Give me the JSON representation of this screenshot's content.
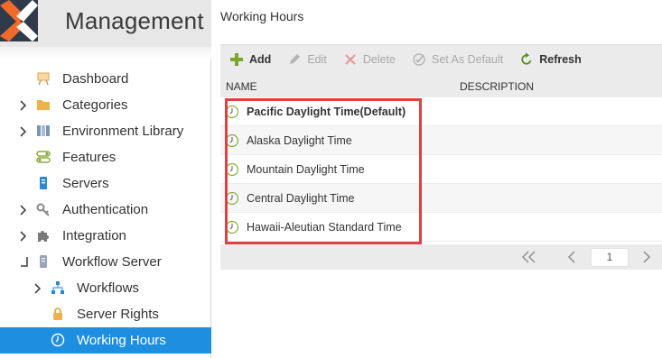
{
  "brand": {
    "title": "Management"
  },
  "sidebar": {
    "items": [
      {
        "label": "Dashboard",
        "icon": "easel-icon"
      },
      {
        "label": "Categories",
        "icon": "folder-icon"
      },
      {
        "label": "Environment Library",
        "icon": "library-icon"
      },
      {
        "label": "Features",
        "icon": "toggle-icon"
      },
      {
        "label": "Servers",
        "icon": "server-icon"
      },
      {
        "label": "Authentication",
        "icon": "key-icon"
      },
      {
        "label": "Integration",
        "icon": "puzzle-icon"
      },
      {
        "label": "Workflow Server",
        "icon": "server-tower-icon"
      },
      {
        "label": "Workflows",
        "icon": "hierarchy-icon"
      },
      {
        "label": "Server Rights",
        "icon": "lock-icon"
      },
      {
        "label": "Working Hours",
        "icon": "clock-icon"
      }
    ]
  },
  "page": {
    "title": "Working Hours"
  },
  "toolbar": {
    "add": "Add",
    "edit": "Edit",
    "delete": "Delete",
    "set_default": "Set As Default",
    "refresh": "Refresh"
  },
  "table": {
    "columns": [
      "NAME",
      "DESCRIPTION"
    ],
    "rows": [
      {
        "name": "Pacific Daylight Time(Default)",
        "description": ""
      },
      {
        "name": "Alaska Daylight Time",
        "description": ""
      },
      {
        "name": "Mountain Daylight Time",
        "description": ""
      },
      {
        "name": "Central Daylight Time",
        "description": ""
      },
      {
        "name": "Hawaii-Aleutian Standard Time",
        "description": ""
      }
    ]
  },
  "pager": {
    "page": "1"
  },
  "colors": {
    "accent": "#1e8ee0",
    "highlight": "#e04040",
    "add_green": "#7aa62c",
    "clock_green": "#8cab3c",
    "brand_orange": "#f26a2b"
  }
}
